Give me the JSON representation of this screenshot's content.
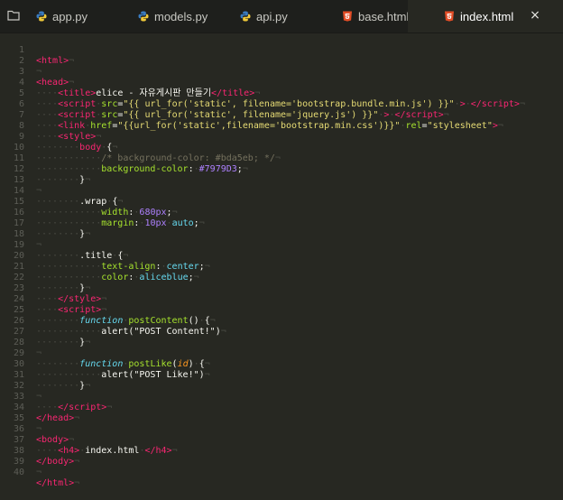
{
  "tabs": [
    {
      "label": "app.py",
      "icon": "python-icon"
    },
    {
      "label": "models.py",
      "icon": "python-icon"
    },
    {
      "label": "api.py",
      "icon": "python-icon"
    },
    {
      "label": "base.html",
      "icon": "html5-icon"
    },
    {
      "label": "index.html",
      "icon": "html5-icon",
      "active": true
    }
  ],
  "close_glyph": "×",
  "line_numbers": [
    "1",
    "2",
    "3",
    "4",
    "5",
    "6",
    "7",
    "8",
    "9",
    "10",
    "11",
    "12",
    "13",
    "14",
    "15",
    "16",
    "17",
    "18",
    "19",
    "20",
    "21",
    "22",
    "23",
    "24",
    "25",
    "26",
    "27",
    "28",
    "29",
    "30",
    "31",
    "32",
    "33",
    "34",
    "35",
    "36",
    "37",
    "38",
    "39",
    "40"
  ],
  "code": {
    "title_text": "elice - 자유게시판 만들기",
    "bootstrap_js": "{{ url_for('static', filename='bootstrap.bundle.min.js') }}",
    "jquery_js": "{{ url_for('static', filename='jquery.js') }}",
    "bootstrap_css": "{{url_for('static',filename='bootstrap.min.css')}}",
    "rel_value": "stylesheet",
    "body_selector": "body",
    "comment_bg": "/* background-color: #bda5eb; */",
    "bg_prop": "background-color",
    "bg_value": "#7979D3",
    "wrap_selector": ".wrap",
    "width_prop": "width",
    "width_value": "680px",
    "margin_prop": "margin",
    "margin_value_num": "10px",
    "margin_value_kw": "auto",
    "title_selector": ".title",
    "text_align_prop": "text-align",
    "text_align_value": "center",
    "color_prop": "color",
    "color_value": "aliceblue",
    "fn1_name": "postContent",
    "fn1_alert": "\"POST Content!\"",
    "fn2_name": "postLike",
    "fn2_param": "id",
    "fn2_alert": "\"POST Like!\"",
    "h4_text": "index.html"
  },
  "colors": {
    "background": "#272822",
    "tag": "#f92672",
    "attribute": "#a6e22e",
    "string": "#e6db74",
    "property": "#66d9ef",
    "number": "#ae81ff",
    "comment": "#75715e",
    "whitespace": "#4a4b44"
  }
}
